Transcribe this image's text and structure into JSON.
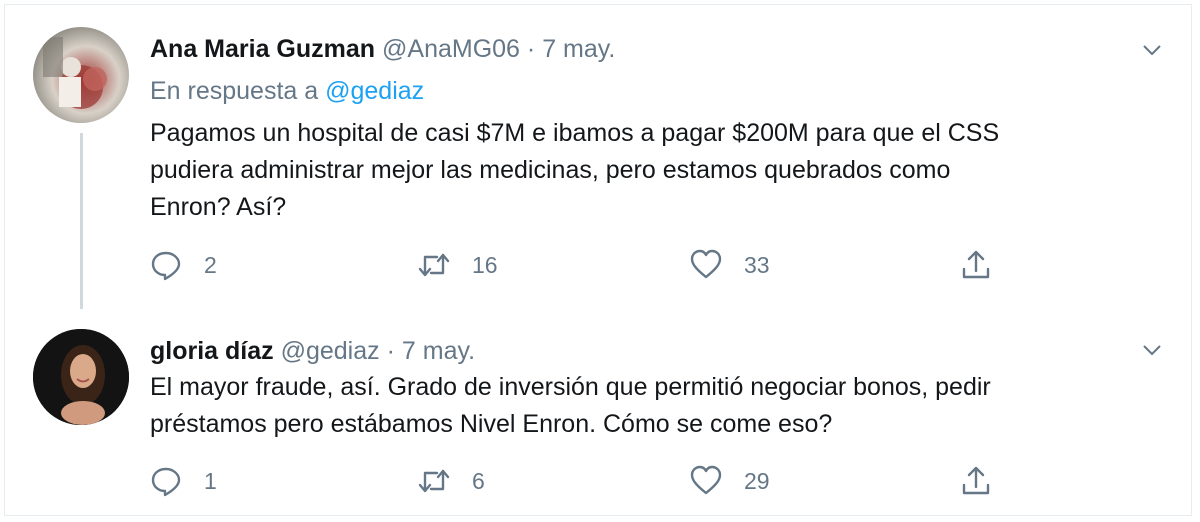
{
  "tweets": [
    {
      "name": "Ana Maria Guzman",
      "handle": "@AnaMG06",
      "separator": "·",
      "date": "7 may.",
      "reply_prefix": "En respuesta a",
      "reply_mention": "@gediaz",
      "text_lines": [
        "Pagamos un hospital de casi $7M e ibamos a pagar $200M para que el CSS",
        "pudiera administrar mejor las medicinas, pero estamos quebrados como",
        "Enron? Así?"
      ],
      "replies": "2",
      "retweets": "16",
      "likes": "33"
    },
    {
      "name": "gloria díaz",
      "handle": "@gediaz",
      "separator": "·",
      "date": "7 may.",
      "text_lines": [
        "El mayor fraude, así. Grado de inversión que permitió negociar bonos, pedir",
        "préstamos pero estábamos Nivel Enron. Cómo se come eso?"
      ],
      "replies": "1",
      "retweets": "6",
      "likes": "29"
    }
  ],
  "icons": {
    "reply": "reply-icon",
    "retweet": "retweet-icon",
    "like": "heart-icon",
    "share": "share-icon",
    "more": "chevron-down-icon"
  },
  "colors": {
    "text": "#14171a",
    "secondary": "#657786",
    "link": "#1da1f2",
    "border": "#e6ecf0",
    "thread_line": "#cfd9de"
  }
}
